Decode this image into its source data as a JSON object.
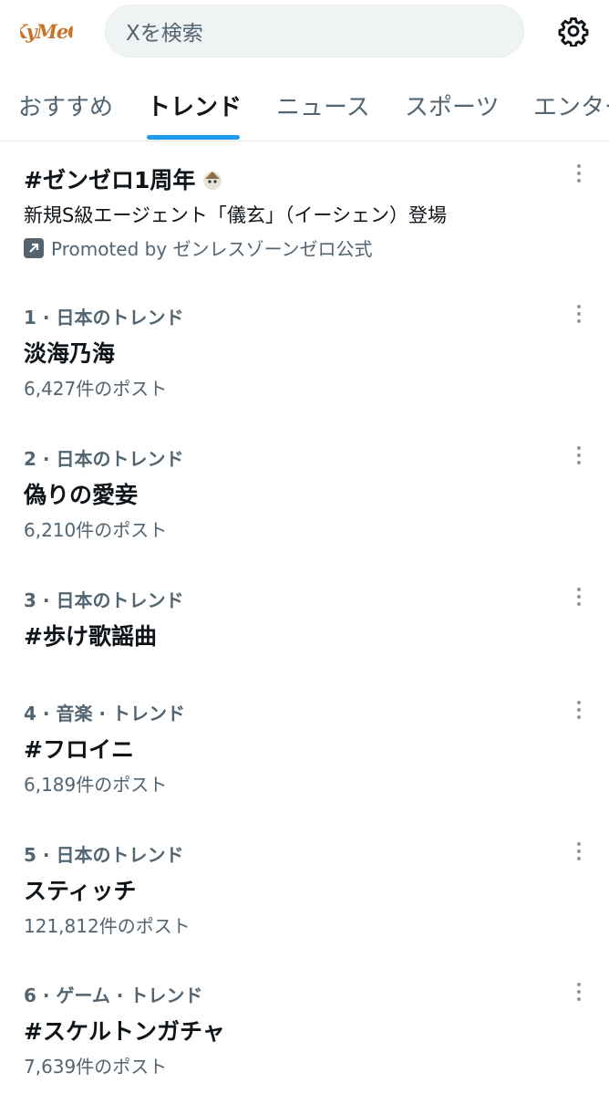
{
  "header": {
    "avatar_text": "KyMeC",
    "search_placeholder": "Xを検索"
  },
  "tabs": [
    {
      "label": "おすすめ",
      "active": false
    },
    {
      "label": "トレンド",
      "active": true
    },
    {
      "label": "ニュース",
      "active": false
    },
    {
      "label": "スポーツ",
      "active": false
    },
    {
      "label": "エンター",
      "active": false
    }
  ],
  "promoted": {
    "title": "#ゼンゼロ1周年",
    "description": "新規S級エージェント「儀玄」（イーシェン）登場",
    "promoted_by": "Promoted by ゼンレスゾーンゼロ公式"
  },
  "trends": [
    {
      "meta": "1 · 日本のトレンド",
      "title": "淡海乃海",
      "count": "6,427件のポスト"
    },
    {
      "meta": "2 · 日本のトレンド",
      "title": "偽りの愛妾",
      "count": "6,210件のポスト"
    },
    {
      "meta": "3 · 日本のトレンド",
      "title": "#歩け歌謡曲",
      "count": ""
    },
    {
      "meta": "4 · 音楽 · トレンド",
      "title": "#フロイニ",
      "count": "6,189件のポスト"
    },
    {
      "meta": "5 · 日本のトレンド",
      "title": "スティッチ",
      "count": "121,812件のポスト"
    },
    {
      "meta": "6 · ゲーム · トレンド",
      "title": "#スケルトンガチャ",
      "count": "7,639件のポスト"
    }
  ],
  "colors": {
    "accent": "#1d9bf0",
    "secondary_text": "#536471",
    "primary_text": "#0f1419"
  }
}
